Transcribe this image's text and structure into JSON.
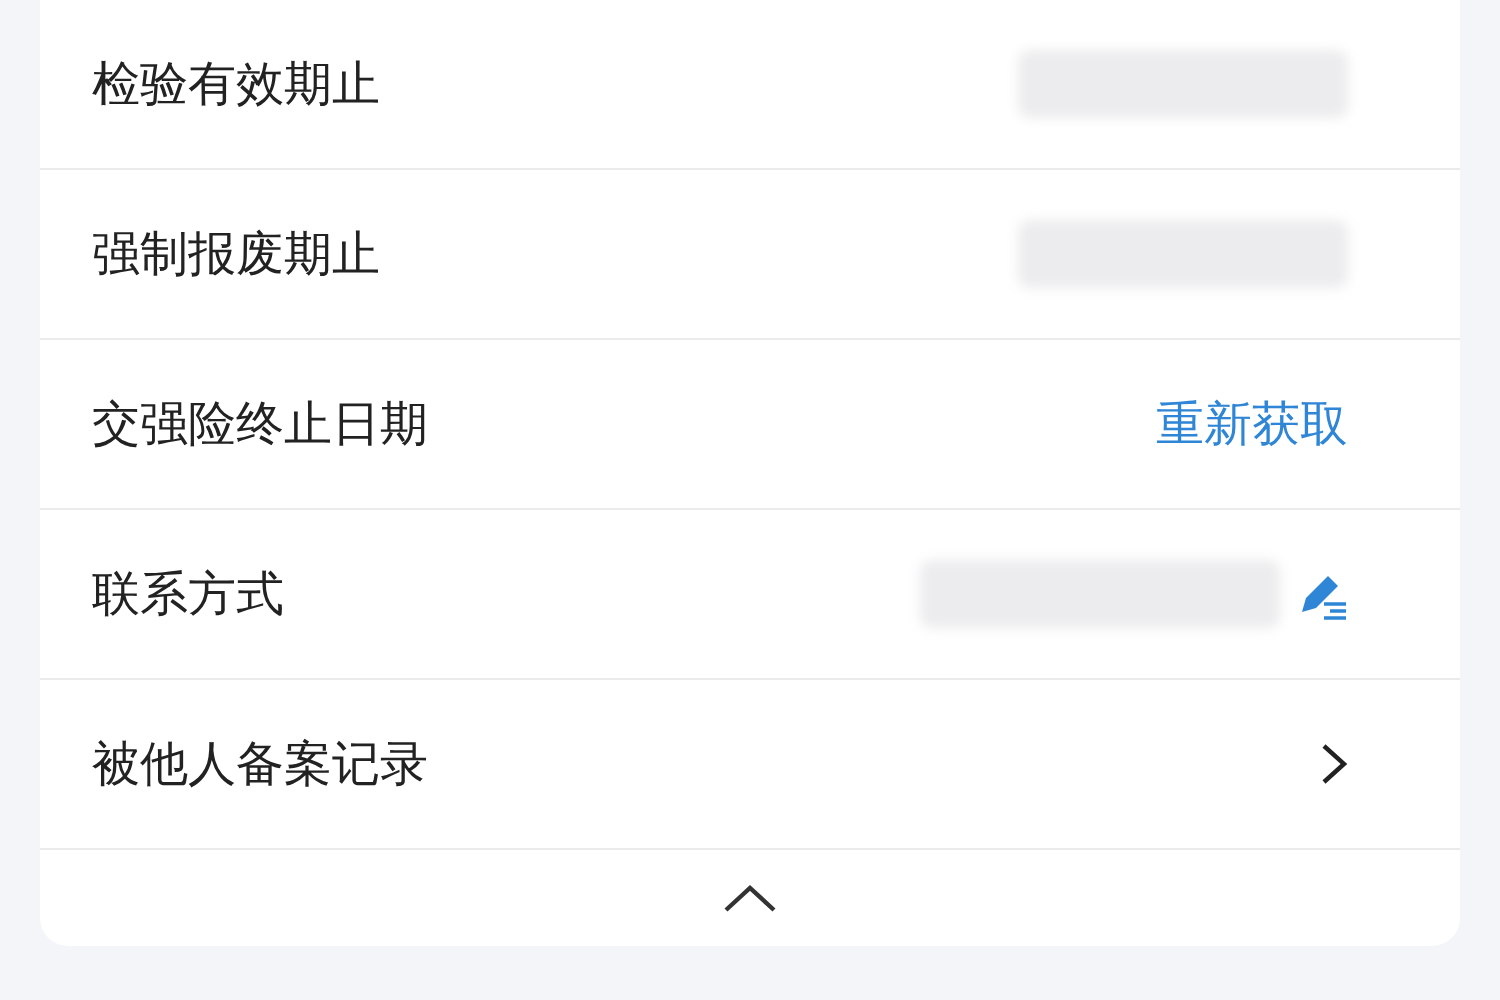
{
  "rows": [
    {
      "label": "检验有效期止",
      "kind": "redacted"
    },
    {
      "label": "强制报废期止",
      "kind": "redacted"
    },
    {
      "label": "交强险终止日期",
      "kind": "link",
      "action": "重新获取"
    },
    {
      "label": "联系方式",
      "kind": "redacted_edit"
    },
    {
      "label": "被他人备案记录",
      "kind": "chevron"
    }
  ]
}
